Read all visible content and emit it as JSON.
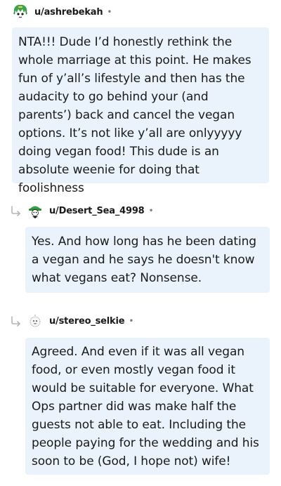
{
  "comments": [
    {
      "username": "u/ashrebekah",
      "separator": "•",
      "avatar": "green-haired-avatar-icon",
      "text": "NTA!!! Dude I’d honestly rethink the whole marriage at this point. He makes fun of y’all’s lifestyle and then has the audacity to go behind your (and parents’) back and cancel the vegan options. It’s not like y’all are onlyyyyy doing vegan food! This dude is an absolute weenie for doing that foolishness"
    },
    {
      "username": "u/Desert_Sea_4998",
      "separator": "•",
      "avatar": "green-hat-avatar-icon",
      "text": "Yes. And how long has he been dating a vegan and he says he doesn't know what vegans eat? Nonsense."
    },
    {
      "username": "u/stereo_selkie",
      "separator": "•",
      "avatar": "white-avatar-icon",
      "text": "Agreed. And even if it was all vegan food, or even mostly vegan food it would be suitable for everyone. What Ops partner did was make half the guests not able to eat. Including the people paying for the wedding and his soon to be (God, I hope not) wife!"
    }
  ],
  "colors": {
    "bubble": "#eaf3fb",
    "text": "#1a1a1b",
    "meta": "#7c7c7c",
    "arrow": "#b5b5b5"
  }
}
